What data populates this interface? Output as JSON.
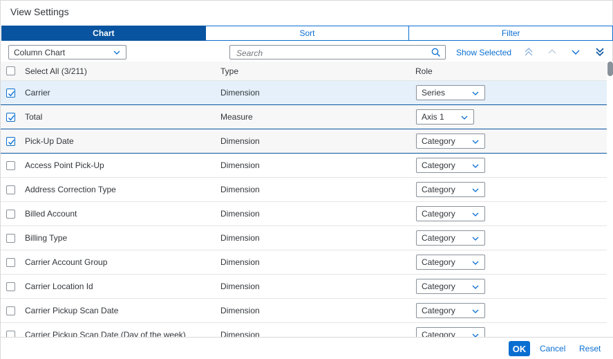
{
  "dialog": {
    "title": "View Settings"
  },
  "tabs": [
    {
      "label": "Chart",
      "active": true
    },
    {
      "label": "Sort",
      "active": false
    },
    {
      "label": "Filter",
      "active": false
    }
  ],
  "toolbar": {
    "chart_type": "Column Chart",
    "search_placeholder": "Search",
    "show_selected": "Show Selected",
    "icons": [
      "move-to-top-icon",
      "move-up-icon",
      "move-down-icon",
      "move-to-bottom-icon"
    ]
  },
  "table": {
    "select_all": "Select All (3/211)",
    "columns": {
      "type": "Type",
      "role": "Role"
    },
    "rows": [
      {
        "name": "Carrier",
        "type": "Dimension",
        "role": "Series",
        "checked": true
      },
      {
        "name": "Total",
        "type": "Measure",
        "role": "Axis 1",
        "checked": true
      },
      {
        "name": "Pick-Up Date",
        "type": "Dimension",
        "role": "Category",
        "checked": true
      },
      {
        "name": "Access Point Pick-Up",
        "type": "Dimension",
        "role": "Category",
        "checked": false
      },
      {
        "name": "Address Correction Type",
        "type": "Dimension",
        "role": "Category",
        "checked": false
      },
      {
        "name": "Billed Account",
        "type": "Dimension",
        "role": "Category",
        "checked": false
      },
      {
        "name": "Billing Type",
        "type": "Dimension",
        "role": "Category",
        "checked": false
      },
      {
        "name": "Carrier Account Group",
        "type": "Dimension",
        "role": "Category",
        "checked": false
      },
      {
        "name": "Carrier Location Id",
        "type": "Dimension",
        "role": "Category",
        "checked": false
      },
      {
        "name": "Carrier Pickup Scan Date",
        "type": "Dimension",
        "role": "Category",
        "checked": false
      },
      {
        "name": "Carrier Pickup Scan Date (Day of the week)",
        "type": "Dimension",
        "role": "Category",
        "checked": false
      }
    ]
  },
  "footer": {
    "ok": "OK",
    "cancel": "Cancel",
    "reset": "Reset"
  },
  "colors": {
    "accent": "#0a6ed1",
    "active_tab": "#0854a0"
  }
}
